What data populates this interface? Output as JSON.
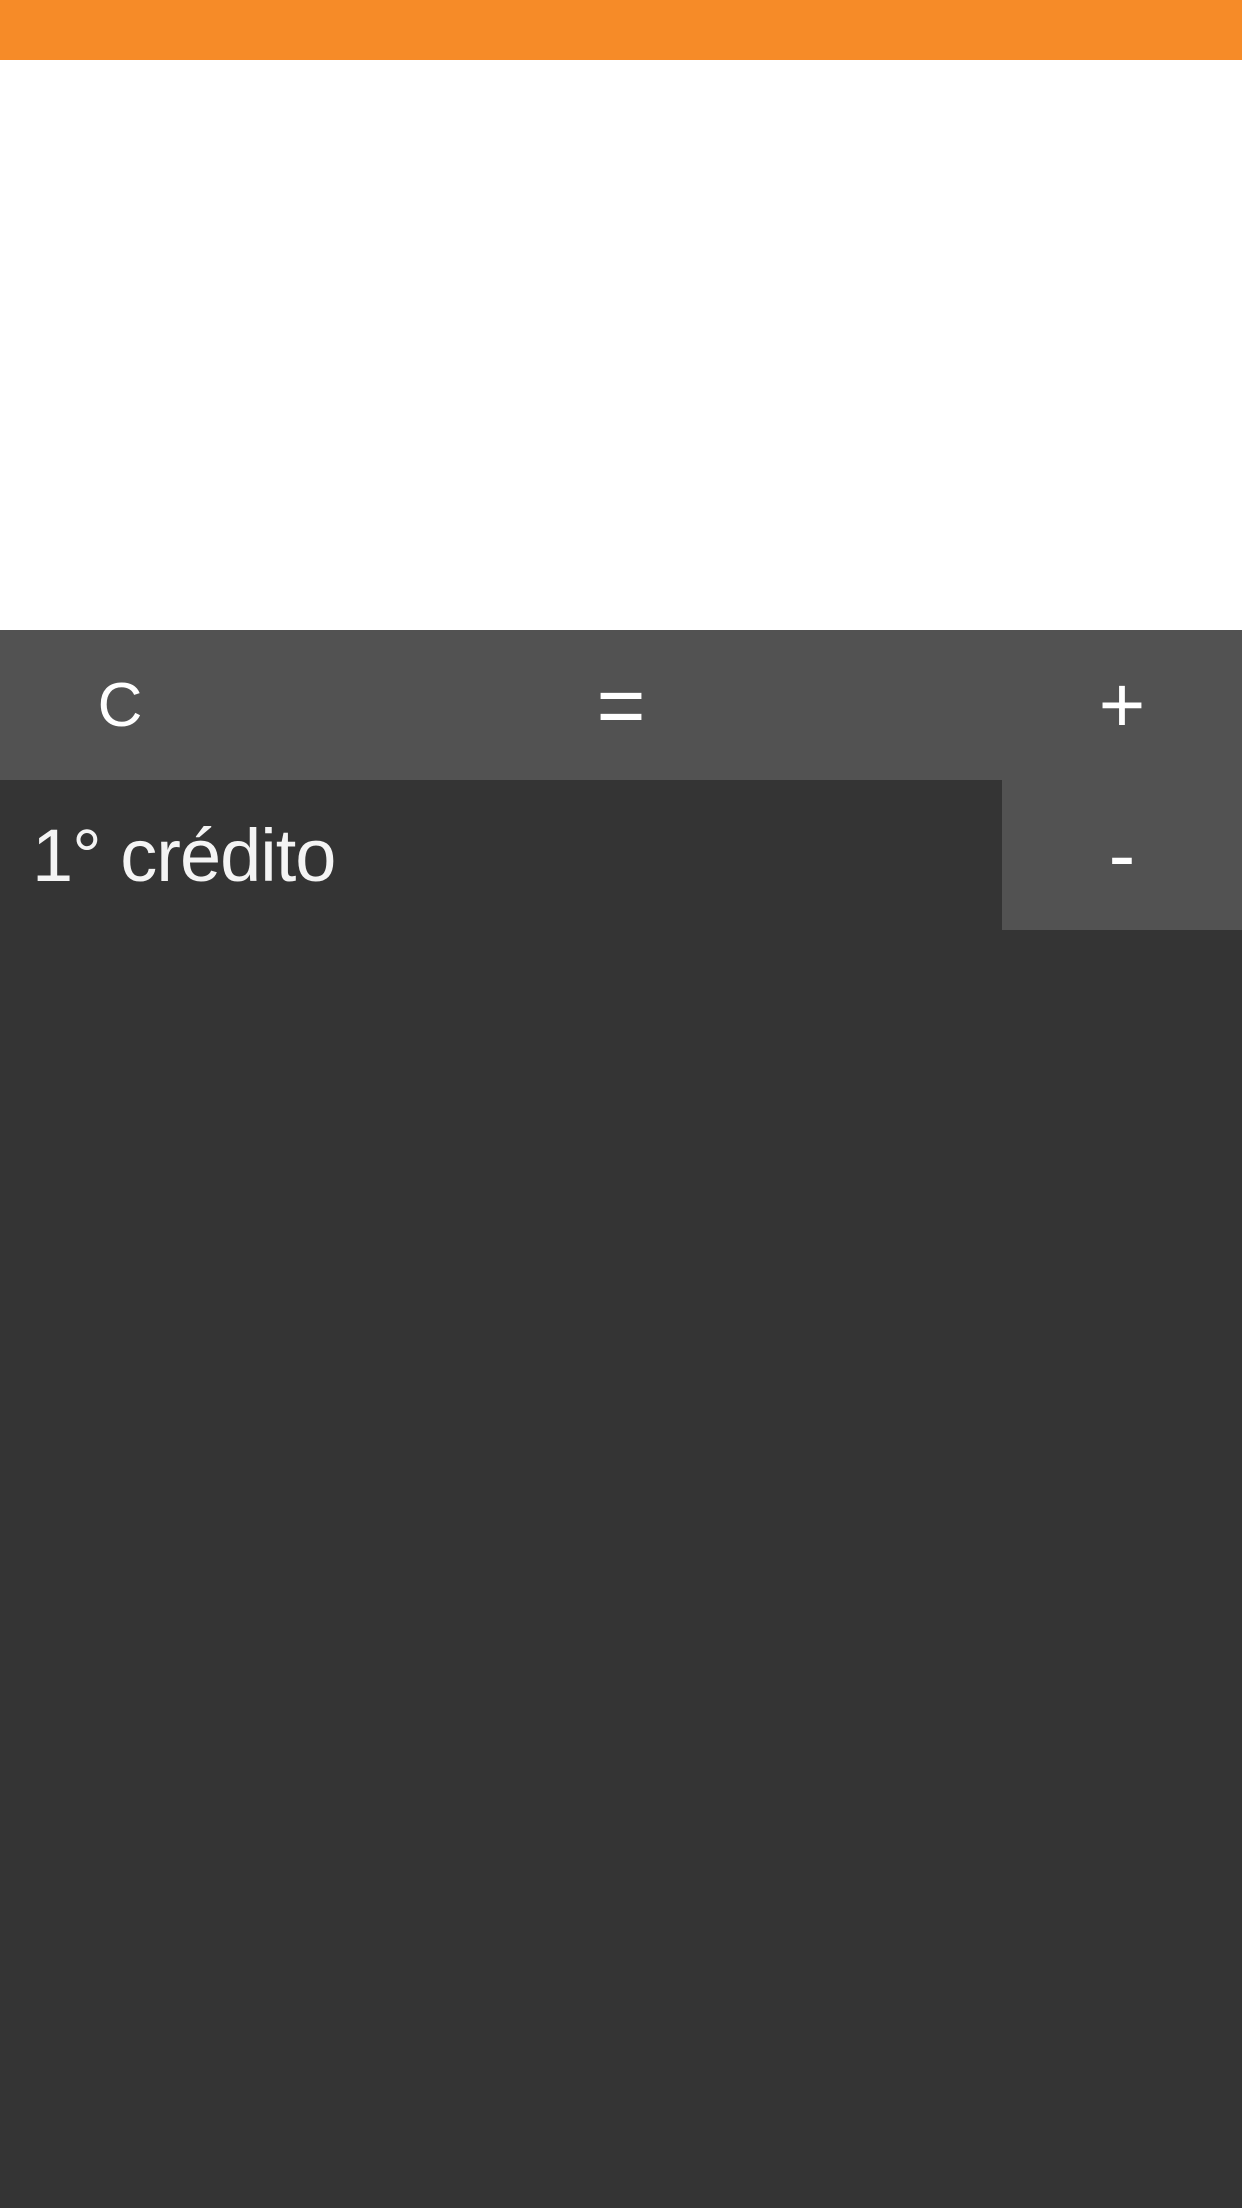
{
  "colors": {
    "status_bar": "#f68b28",
    "display_bg": "#ffffff",
    "key_bg": "#525252",
    "body_bg": "#343434",
    "text": "#ffffff"
  },
  "keys": {
    "clear": "C",
    "equals": "=",
    "plus": "+",
    "minus": "-"
  },
  "list": {
    "items": [
      {
        "label": "1° crédito"
      }
    ]
  }
}
